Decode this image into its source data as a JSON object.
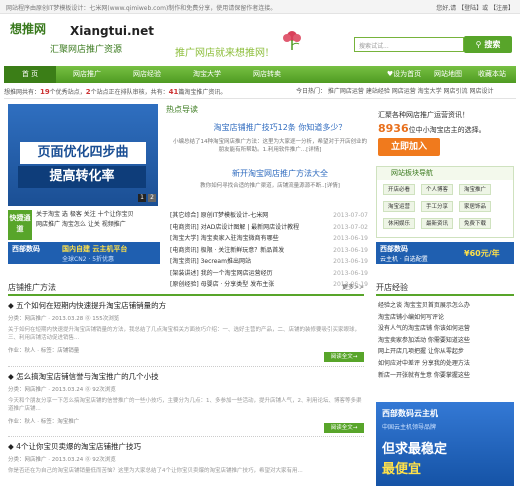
{
  "topbar": {
    "left": "网站程序由原创IT梦模板设计：七米网(www.qimiweb.com)制作和免费分享，使用请保留作者连接。",
    "right": "您好,请 【登陆】或 【注册】"
  },
  "logo": {
    "cn": "想推网",
    "en": "Xiangtui.net",
    "slogan": "汇聚网店推广资源",
    "tagline": "推广网店就来想推网!"
  },
  "search": {
    "placeholder": "搜索试试...",
    "button": "搜索"
  },
  "nav": {
    "items": [
      "首 页",
      "网店推广",
      "网店经验",
      "淘宝大学",
      "网店转卖"
    ],
    "right": [
      "♥设为首页",
      "网站地图",
      "收藏本站"
    ]
  },
  "stats": {
    "prefix": "想推网共有：",
    "n1": "19",
    "t1": "个优秀站点，",
    "n2": "2",
    "t2": "个站点正在排队审核，共有：",
    "n3": "41",
    "t3": "篇淘宝推广资讯。"
  },
  "sublinks": "今日热门： 推广网店运营 建站经验 网店运营 淘宝大学 网店引流 网店设计",
  "banner": {
    "l1": "页面优化四步曲",
    "l2": "提高转化率",
    "page1": "1",
    "page2": "2"
  },
  "quick": {
    "label": "快捷通道",
    "lines": [
      "关于淘宝   选   极客   关注   十个让你宝贝",
      "网店推广   淘宝怎么   让关   视频推广"
    ]
  },
  "ad1": {
    "brand": "西部数码",
    "text": "国内自建 云主机平台",
    "sub": "全球CN2 · 5折优惠"
  },
  "hot": {
    "heading": "热点导读",
    "t1": "淘宝店铺推广技巧12条 你知道多少？",
    "p": "小编总结了14种淘宝网店推广方法：这里为大家逐一分析，希望对于开店创业的朋友能有所帮助。1.利用软件推广...[详情]",
    "t2": "新开淘宝网店推广方法大全",
    "p2": "教你如何寻找合适的推广渠道，店铺流量源源不断..[详情]"
  },
  "news": [
    {
      "t": "[其它综合] 原创IT梦模板设计-七米网",
      "d": "2013-07-07"
    },
    {
      "t": "[电商资讯] 对AD店设计图解 | 最新网店设计教程",
      "d": "2013-07-02"
    },
    {
      "t": "[淘宝大学] 淘宝卖家入驻淘宝微商有哪些",
      "d": "2013-06-19"
    },
    {
      "t": "[电商资讯] 极限 · 关注新鲜玩意？新品首发",
      "d": "2013-06-19"
    },
    {
      "t": "[淘宝资讯] 3ecream推出网站",
      "d": "2013-06-19"
    },
    {
      "t": "[架装讲述] 我的一个淘宝网店运营经历",
      "d": "2013-06-19"
    },
    {
      "t": "[原创经验] 母婴店 · 分享类型 发布主张",
      "d": "2013-06-19"
    }
  ],
  "right_top": {
    "l1": "汇聚各种网店推广运营资讯！",
    "n": "8936",
    "l2": "位中小淘宝店主的选择。",
    "btn": "立即加入"
  },
  "tagbox": {
    "heading": "网站板块导航",
    "tags": [
      "开店必看",
      "个人博客",
      "淘宝推广",
      "淘宝运营",
      "手工分享",
      "家居饰品",
      "休闲娱乐",
      "最新资讯",
      "免费下载"
    ]
  },
  "ad2": {
    "brand": "西部数码",
    "text": "云主机 · 自选配置",
    "price": "¥60元/年"
  },
  "section": {
    "heading": "店铺推广方法",
    "more": "更多>>"
  },
  "articles": [
    {
      "title": "五个如何在短期内快速提升淘宝店铺销量的方",
      "meta": "分类：网店推广 · 2013.03.28  ⓪ 155次浏览",
      "body": "关于如何在短期内快速提升淘宝店铺销量的方法，我总结了几点淘宝相关方面技巧介绍：一、选好主营的产品，二、店铺的装修要吸引买家眼球，三、利用店铺活动促进销售...",
      "tags": "作业：秋人 · 标签：店铺销量",
      "btn": "阅读全文→"
    },
    {
      "title": "怎么搞淘宝店铺信誉与淘宝推广的几个小技",
      "meta": "分类：网店推广 · 2013.03.24  ⓪ 92次浏览",
      "body": "今天和个朋友分享一下怎么搞淘宝店铺的信誉推广的一些小技巧，主要分为几点：1、多参加一些活动，提升店铺人气，2、利用论坛、博客等多渠道推广店铺...",
      "tags": "作业：秋人 · 标签：淘宝推广",
      "btn": "阅读全文→"
    },
    {
      "title": "4个让你宝贝卖爆的淘宝店铺推广技巧",
      "meta": "分类：网店推广 · 2013.03.24  ⓪ 92次浏览",
      "body": "你是否还在为自己的淘宝店铺销量低而苦恼？这里为大家总结了4个让你宝贝卖爆的淘宝店铺推广技巧，希望对大家有用..."
    }
  ],
  "right_section": {
    "heading": "开店经验",
    "items": [
      "经验之谈 淘宝宝贝首页展示怎么办",
      "淘宝店铺小编如何写评论",
      "没有人气的淘宝店铺 你该如何运营",
      "淘宝卖家参加活动 你需要知道这些",
      "网上开店几项把握 让你从零起步",
      "如何应对中差评 分享我的处理方法",
      "新店一开张就有生意 你要掌握这些"
    ]
  },
  "ad3": {
    "brand": "西部数码云主机",
    "line1": "中国云主机领导品牌",
    "line2": "但求最稳定",
    "line3": "最便宜"
  },
  "colors": {
    "green": "#58a52a",
    "orange": "#f07a1d",
    "blue": "#1f5fb0"
  }
}
